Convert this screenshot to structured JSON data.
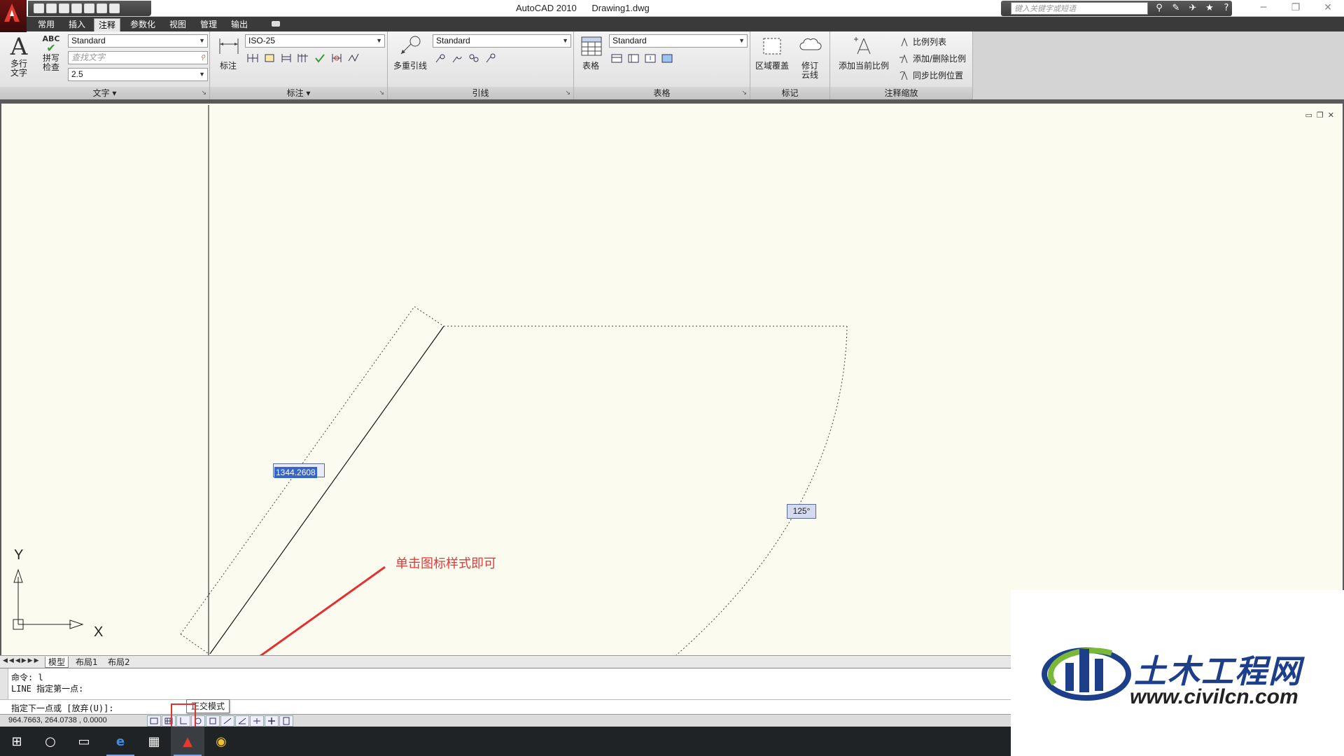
{
  "window": {
    "app_title": "AutoCAD 2010",
    "doc_title": "Drawing1.dwg",
    "search_placeholder": "键入关键字或短语"
  },
  "tabs": [
    "常用",
    "插入",
    "注释",
    "参数化",
    "视图",
    "管理",
    "输出"
  ],
  "active_tab": "注释",
  "ribbon": {
    "text_panel": {
      "mtext_label": "多行文字",
      "spell_label": "拼写检查",
      "abc_label": "ABC",
      "style_value": "Standard",
      "find_placeholder": "查找文字",
      "height_value": "2.5",
      "footer": "文字"
    },
    "dim_panel": {
      "dim_label": "标注",
      "style_value": "ISO-25",
      "footer": "标注"
    },
    "leader_panel": {
      "mleader_label": "多重引线",
      "style_value": "Standard",
      "footer": "引线"
    },
    "table_panel": {
      "table_label": "表格",
      "style_value": "Standard",
      "footer": "表格"
    },
    "markup_panel": {
      "wipeout_label": "区域覆盖",
      "revcloud_label": "修订云线",
      "footer": "标记"
    },
    "scale_panel": {
      "add_scale_label": "添加当前比例",
      "scale_list": "比例列表",
      "add_delete": "添加/删除比例",
      "sync": "同步比例位置",
      "footer": "注释缩放"
    }
  },
  "canvas": {
    "length_input": "1344.2608",
    "angle_tip": "125°",
    "annotation": "单击图标样式即可",
    "ucs_x": "X",
    "ucs_y": "Y"
  },
  "layout_tabs": [
    "模型",
    "布局1",
    "布局2"
  ],
  "command": {
    "line1": "命令: l",
    "line2": "LINE 指定第一点:",
    "prompt": "指定下一点或 [放弃(U)]:"
  },
  "status": {
    "coords": "964.7663,  264.0738 ,  0.0000",
    "tooltip": "正交模式"
  },
  "watermark": {
    "cn": "土木工程网",
    "url": "www.civilcn.com"
  },
  "colors": {
    "canvas_bg": "#fcfbf0",
    "accent_red": "#e53030",
    "selection_blue": "#3565c8"
  }
}
